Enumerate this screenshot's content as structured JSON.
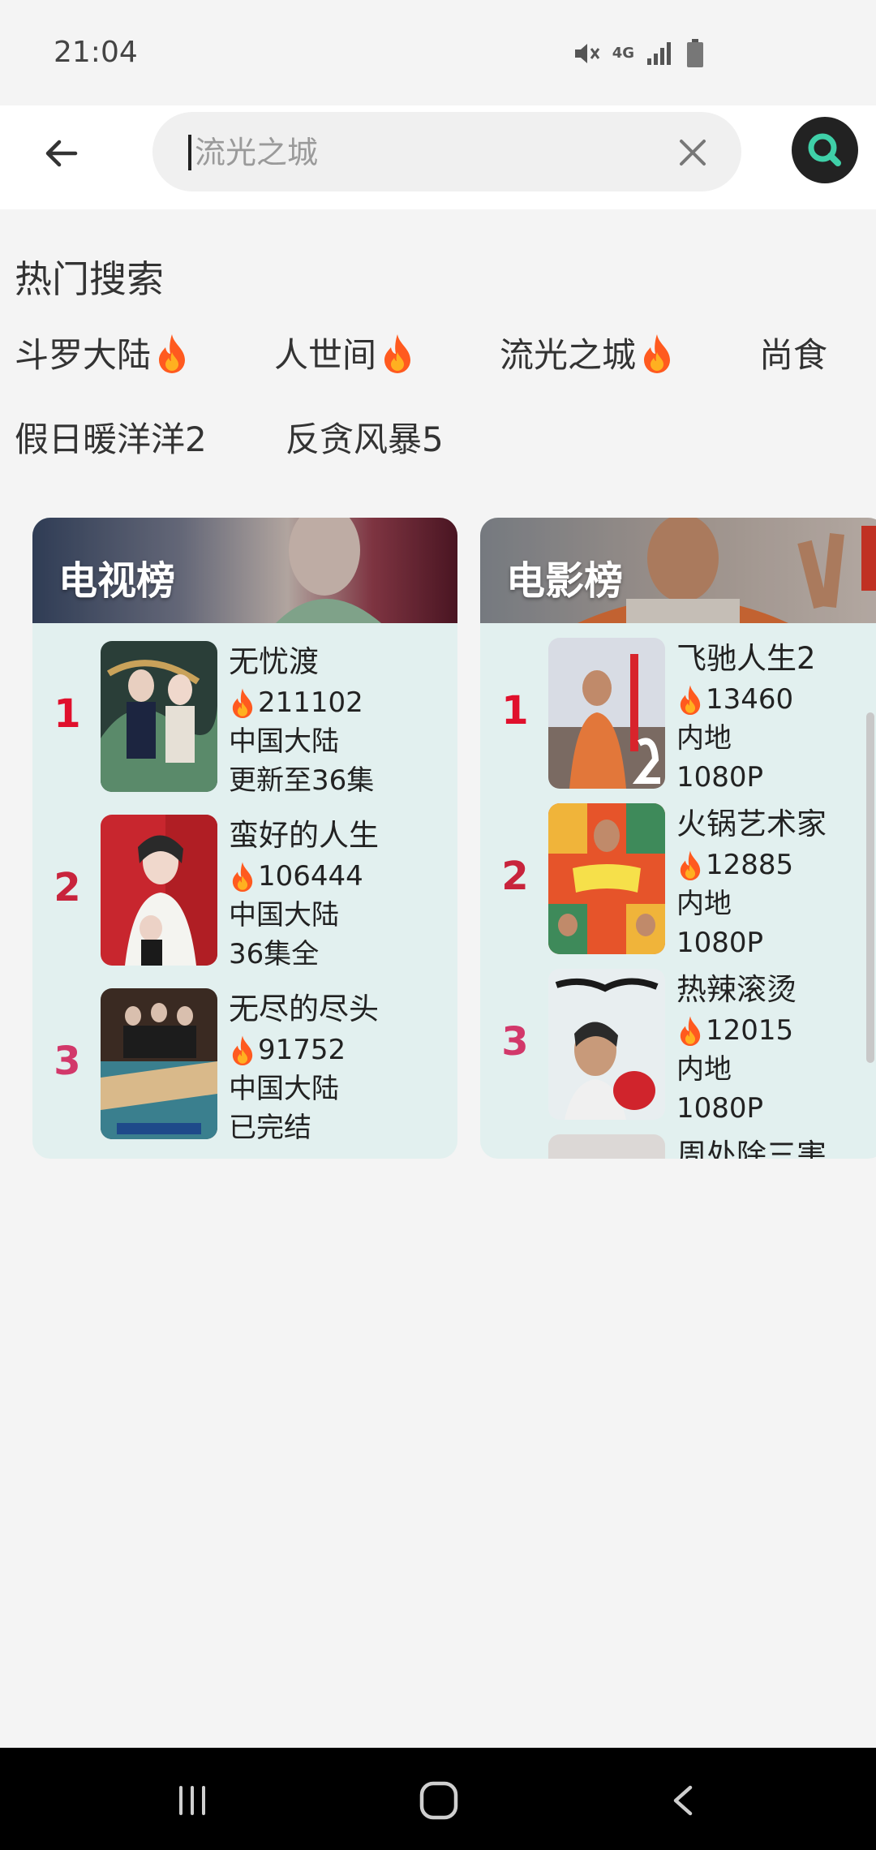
{
  "status_bar": {
    "time": "21:04",
    "network": "4G",
    "icons": [
      "mute-icon",
      "network-4g-icon",
      "signal-icon",
      "battery-icon"
    ]
  },
  "search": {
    "placeholder": "流光之城",
    "value": ""
  },
  "hot_search": {
    "title": "热门搜索",
    "rows": [
      [
        {
          "label": "斗罗大陆",
          "hot": true
        },
        {
          "label": "人世间",
          "hot": true
        },
        {
          "label": "流光之城",
          "hot": true
        },
        {
          "label": "尚食",
          "hot": false
        }
      ],
      [
        {
          "label": "假日暖洋洋2",
          "hot": false
        },
        {
          "label": "反贪风暴5",
          "hot": false
        }
      ]
    ]
  },
  "tv_chart": {
    "title": "电视榜",
    "items": [
      {
        "rank": "1",
        "title": "无忧渡",
        "heat": "211102",
        "region": "中国大陆",
        "status": "更新至36集"
      },
      {
        "rank": "2",
        "title": "蛮好的人生",
        "heat": "106444",
        "region": "中国大陆",
        "status": "36集全"
      },
      {
        "rank": "3",
        "title": "无尽的尽头",
        "heat": "91752",
        "region": "中国大陆",
        "status": "已完结"
      }
    ]
  },
  "movie_chart": {
    "title": "电影榜",
    "items": [
      {
        "rank": "1",
        "title": "飞驰人生2",
        "heat": "13460",
        "region": "内地",
        "quality": "1080P"
      },
      {
        "rank": "2",
        "title": "火锅艺术家",
        "heat": "12885",
        "region": "内地",
        "quality": "1080P"
      },
      {
        "rank": "3",
        "title": "热辣滚烫",
        "heat": "12015",
        "region": "内地",
        "quality": "1080P"
      }
    ],
    "partial_next_title": "周处除三害"
  },
  "colors": {
    "rank_red": "#e0102c",
    "rank_dark_red": "#c8243c",
    "rank_pink": "#d2386a",
    "card_bg": "#e2f0ef",
    "search_button_bg": "#222222",
    "search_button_accent": "#3fd0a8"
  }
}
